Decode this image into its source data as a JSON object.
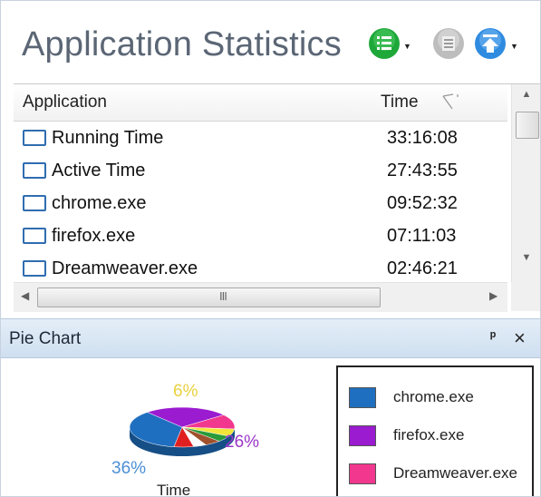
{
  "header": {
    "title": "Application Statistics",
    "buttons": [
      {
        "name": "view-options",
        "icon": "list-icon",
        "color": "#1fa83a",
        "dropdown": true
      },
      {
        "name": "details",
        "icon": "details-icon",
        "color": "#b9b9b9",
        "dropdown": false
      },
      {
        "name": "export",
        "icon": "upload-icon",
        "color": "#2f8be0",
        "dropdown": true
      }
    ]
  },
  "table": {
    "columns": [
      "Application",
      "Time"
    ],
    "rows": [
      {
        "name": "Running Time",
        "time": "33:16:08"
      },
      {
        "name": "Active Time",
        "time": "27:43:55"
      },
      {
        "name": "chrome.exe",
        "time": "09:52:32"
      },
      {
        "name": "firefox.exe",
        "time": "07:11:03"
      },
      {
        "name": "Dreamweaver.exe",
        "time": "02:46:21"
      }
    ],
    "hscroll_grip": "III"
  },
  "pie_panel": {
    "title": "Pie Chart",
    "pin_glyph": "ᵖ",
    "close_glyph": "×"
  },
  "chart_data": {
    "type": "pie",
    "xlabel": "Time",
    "slices": [
      {
        "name": "chrome.exe",
        "value": 36,
        "label": "36%",
        "color": "#1f6fc0"
      },
      {
        "name": "firefox.exe",
        "value": 26,
        "label": "26%",
        "color": "#9a1bd0"
      },
      {
        "name": "Dreamweaver.exe",
        "value": 12,
        "color": "#f2378e"
      },
      {
        "name": "",
        "value": 6,
        "label": "6%",
        "color": "#f2e53a"
      },
      {
        "name": "",
        "value": 5,
        "color": "#2a9a3a"
      },
      {
        "name": "",
        "value": 5,
        "color": "#a0522d"
      },
      {
        "name": "",
        "value": 4,
        "color": "#ffffff"
      },
      {
        "name": "",
        "value": 6,
        "color": "#e02020"
      }
    ],
    "legend": [
      {
        "label": "chrome.exe",
        "color": "#1f6fc0"
      },
      {
        "label": "firefox.exe",
        "color": "#9a1bd0"
      },
      {
        "label": "Dreamweaver.exe",
        "color": "#f2378e"
      }
    ],
    "legend_position": "right"
  }
}
